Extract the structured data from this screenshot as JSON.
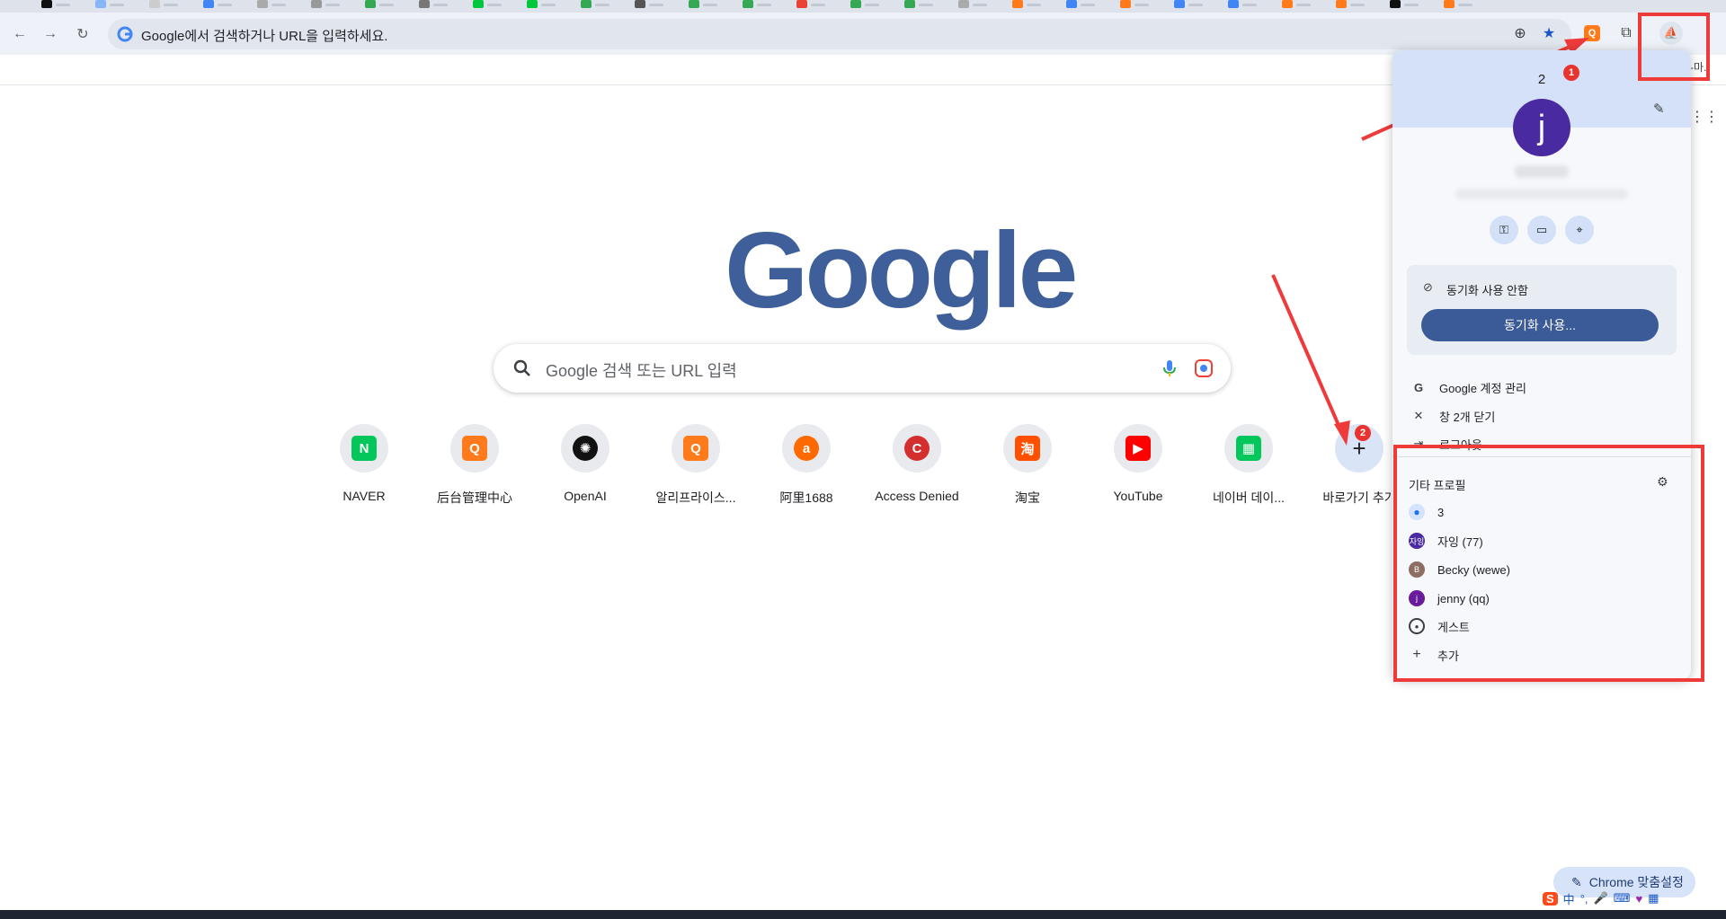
{
  "browser": {
    "omnibox_text": "Google에서 검색하거나 URL을 입력하세요.",
    "bookmark_overflow": "-마.."
  },
  "page": {
    "logo": "Google",
    "search_placeholder": "Google 검색 또는 URL 입력",
    "shortcuts": [
      {
        "label": "NAVER",
        "icon": "naver-icon",
        "color": "#03c75a",
        "glyph": "N"
      },
      {
        "label": "后台管理中心",
        "icon": "search-orange-icon",
        "color": "#ff7a1a",
        "glyph": "Q"
      },
      {
        "label": "OpenAI",
        "icon": "openai-icon",
        "color": "#111111",
        "glyph": "✺"
      },
      {
        "label": "알리프라이스...",
        "icon": "search-orange-icon",
        "color": "#ff7a1a",
        "glyph": "Q"
      },
      {
        "label": "阿里1688",
        "icon": "alibaba-icon",
        "color": "#ff6a00",
        "glyph": "a"
      },
      {
        "label": "Access Denied",
        "icon": "access-denied-icon",
        "color": "#d32f2f",
        "glyph": "C"
      },
      {
        "label": "淘宝",
        "icon": "taobao-icon",
        "color": "#ff5000",
        "glyph": "淘"
      },
      {
        "label": "YouTube",
        "icon": "youtube-icon",
        "color": "#ff0000",
        "glyph": "▶"
      },
      {
        "label": "네이버 데이...",
        "icon": "naver-data-icon",
        "color": "#03c75a",
        "glyph": "▦"
      },
      {
        "label": "바로가기 추가",
        "icon": "plus-icon",
        "color": "#202124",
        "glyph": "+"
      }
    ],
    "customize_button": "Chrome 맞춤설정"
  },
  "profile_menu": {
    "header_count": "2",
    "avatar_letter": "j",
    "sync_off": "동기화 사용 안함",
    "sync_button": "동기화 사용...",
    "items": [
      {
        "label": "Google 계정 관리",
        "icon": "google-g-icon"
      },
      {
        "label": "창 2개 닫기",
        "icon": "close-icon"
      },
      {
        "label": "로그아웃",
        "icon": "logout-icon"
      }
    ],
    "other_profiles_title": "기타 프로필",
    "profiles": [
      {
        "label": "3",
        "icon": "person-icon",
        "color": "#1a73e8",
        "letter": ""
      },
      {
        "label": "자잉 (77)",
        "icon": "avatar-icon",
        "color": "#4a2aa0",
        "letter": "자잉"
      },
      {
        "label": "Becky (wewe)",
        "icon": "avatar-icon",
        "color": "#8d6e63",
        "letter": "B"
      },
      {
        "label": "jenny (qq)",
        "icon": "avatar-icon",
        "color": "#6a1b9a",
        "letter": "j"
      },
      {
        "label": "게스트",
        "icon": "guest-icon",
        "color": "",
        "letter": ""
      },
      {
        "label": "추가",
        "icon": "plus-icon",
        "color": "",
        "letter": ""
      }
    ]
  },
  "annotations": {
    "badge1": "1",
    "badge2": "2",
    "accent": "#ef3a3a"
  }
}
